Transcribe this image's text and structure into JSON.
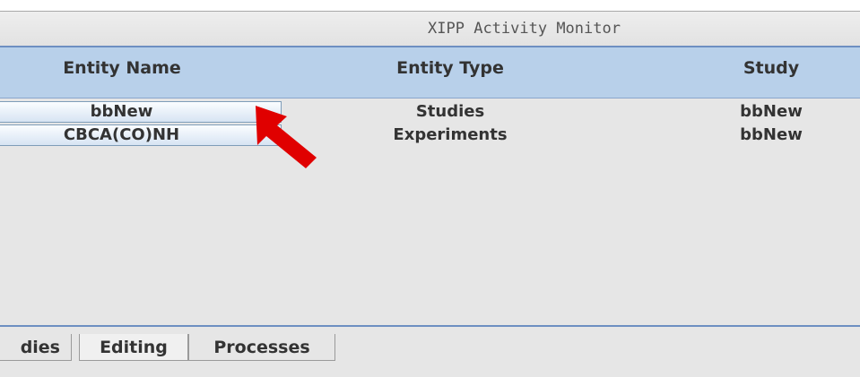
{
  "window": {
    "title": "XIPP Activity Monitor"
  },
  "table": {
    "columns": [
      "Entity Name",
      "Entity Type",
      "Study"
    ],
    "rows": [
      {
        "name": "bbNew",
        "type": "Studies",
        "study": "bbNew"
      },
      {
        "name": "CBCA(CO)NH",
        "type": "Experiments",
        "study": "bbNew"
      }
    ]
  },
  "tabs": [
    {
      "label": "dies"
    },
    {
      "label": "Editing",
      "selected": true
    },
    {
      "label": "Processes"
    }
  ],
  "colors": {
    "header_bg": "#b8d0ea",
    "accent_line": "#6d8fc2",
    "arrow": "#e00000"
  },
  "icons": {
    "annotation": "red-arrow-icon"
  }
}
